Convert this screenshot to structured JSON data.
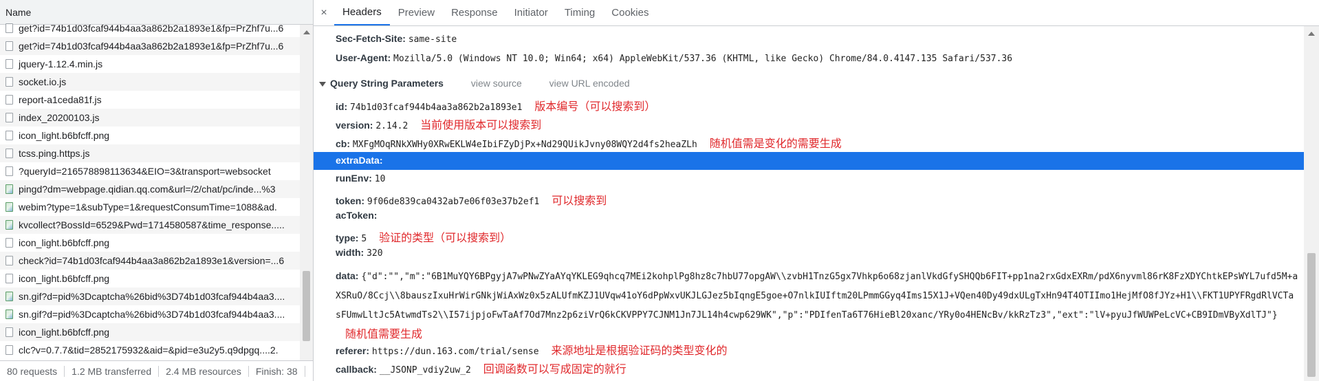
{
  "left_panel": {
    "header_name": "Name",
    "rows": [
      {
        "label": "get?id=74b1d03fcaf944b4aa3a862b2a1893e1&fp=PrZhf7u...6",
        "icon": "file-icon"
      },
      {
        "label": "get?id=74b1d03fcaf944b4aa3a862b2a1893e1&fp=PrZhf7u...6",
        "icon": "file-icon"
      },
      {
        "label": "jquery-1.12.4.min.js",
        "icon": "file-icon"
      },
      {
        "label": "socket.io.js",
        "icon": "file-icon"
      },
      {
        "label": "report-a1ceda81f.js",
        "icon": "file-icon"
      },
      {
        "label": "index_20200103.js",
        "icon": "file-icon"
      },
      {
        "label": "icon_light.b6bfcff.png",
        "icon": "file-icon"
      },
      {
        "label": "tcss.ping.https.js",
        "icon": "file-icon"
      },
      {
        "label": "?queryId=216578898113634&EIO=3&transport=websocket",
        "icon": "file-icon"
      },
      {
        "label": "pingd?dm=webpage.qidian.qq.com&url=/2/chat/pc/inde...%3",
        "icon": "image-icon"
      },
      {
        "label": "webim?type=1&subType=1&requestConsumTime=1088&ad.",
        "icon": "image-icon"
      },
      {
        "label": "kvcollect?BossId=6529&Pwd=1714580587&time_response.....",
        "icon": "image-icon"
      },
      {
        "label": "icon_light.b6bfcff.png",
        "icon": "file-icon"
      },
      {
        "label": "check?id=74b1d03fcaf944b4aa3a862b2a1893e1&version=...6",
        "icon": "file-icon"
      },
      {
        "label": "icon_light.b6bfcff.png",
        "icon": "file-icon"
      },
      {
        "label": "sn.gif?d=pid%3Dcaptcha%26bid%3D74b1d03fcaf944b4aa3....",
        "icon": "image-icon"
      },
      {
        "label": "sn.gif?d=pid%3Dcaptcha%26bid%3D74b1d03fcaf944b4aa3....",
        "icon": "image-icon"
      },
      {
        "label": "icon_light.b6bfcff.png",
        "icon": "file-icon"
      },
      {
        "label": "clc?v=0.7.7&tid=2852175932&aid=&pid=e3u2y5.q9dpgq....2.",
        "icon": "file-icon"
      }
    ],
    "status": {
      "requests": "80 requests",
      "transferred": "1.2 MB transferred",
      "resources": "2.4 MB resources",
      "finish": "Finish: 38"
    }
  },
  "tabs": {
    "close": "×",
    "items": [
      "Headers",
      "Preview",
      "Response",
      "Initiator",
      "Timing",
      "Cookies"
    ],
    "active": "Headers"
  },
  "headers": {
    "sec_fetch_site": {
      "key": "Sec-Fetch-Site:",
      "value": "same-site"
    },
    "user_agent": {
      "key": "User-Agent:",
      "value": "Mozilla/5.0 (Windows NT 10.0; Win64; x64) AppleWebKit/537.36 (KHTML, like Gecko) Chrome/84.0.4147.135 Safari/537.36"
    }
  },
  "query": {
    "title": "Query String Parameters",
    "view_source": "view source",
    "view_url_encoded": "view URL encoded",
    "params": {
      "id": {
        "key": "id:",
        "value": "74b1d03fcaf944b4aa3a862b2a1893e1",
        "note": "版本编号（可以搜索到）"
      },
      "version": {
        "key": "version:",
        "value": "2.14.2",
        "note": "当前使用版本可以搜索到"
      },
      "cb": {
        "key": "cb:",
        "value": "MXFgMOqRNkXWHy0XRwEKLW4eIbiFZyDjPx+Nd29QUikJvny08WQY2d4fs2heaZLh",
        "note": "随机值需是变化的需要生成"
      },
      "extraData": {
        "key": "extraData:"
      },
      "runEnv": {
        "key": "runEnv:",
        "value": "10"
      },
      "token": {
        "key": "token:",
        "value": "9f06de839ca0432ab7e06f03e37b2ef1",
        "note": "可以搜索到"
      },
      "acToken": {
        "key": "acToken:"
      },
      "type": {
        "key": "type:",
        "value": "5",
        "note": "验证的类型（可以搜索到）"
      },
      "width": {
        "key": "width:",
        "value": "320"
      },
      "data": {
        "key": "data:",
        "value": "{\"d\":\"\",\"m\":\"6B1MuYQY6BPgyjA7wPNwZYaAYqYKLEG9qhcq7MEi2kohplPg8hz8c7hbU77opgAW\\\\zvbH1TnzG5gx7Vhkp6o68zjanlVkdGfySHQQb6FIT+pp1na2rxGdxEXRm/pdX6nyvml86rK8FzXDYChtkEPsWYL7ufd5M+aXSRuO/8Ccj\\\\8bauszIxuHrWirGNkjWiAxWz0x5zALUfmKZJ1UVqw41oY6dPpWxvUKJLGJez5bIqngE5goe+O7nlkIUIftm20LPmmGGyq4Ims15X1J+VQen40Dy49dxULgTxHn94T4OTIImo1HejMfO8fJYz+H1\\\\FKT1UPYFRgdRlVCTasFUmwLltJc5AtwmdTs2\\\\I57ijpjoFwTaAf7Od7Mnz2p6ziVrQ6kCKVPPY7CJNM1Jn7JL14h4cwp629WK\",\"p\":\"PDIfenTa6T76HieBl20xanc/YRy0o4HENcBv/kkRzTz3\",\"ext\":\"lV+pyuJfWUWPeLcVC+CB9IDmVByXdlTJ\"}",
        "note": "随机值需要生成"
      },
      "referer": {
        "key": "referer:",
        "value": "https://dun.163.com/trial/sense",
        "note": "来源地址是根据验证码的类型变化的"
      },
      "callback": {
        "key": "callback:",
        "value": "__JSONP_vdiy2uw_2",
        "note": "回调函数可以写成固定的就行"
      }
    }
  },
  "colors": {
    "accent": "#1a73e8",
    "annotation": "#e0292c"
  }
}
